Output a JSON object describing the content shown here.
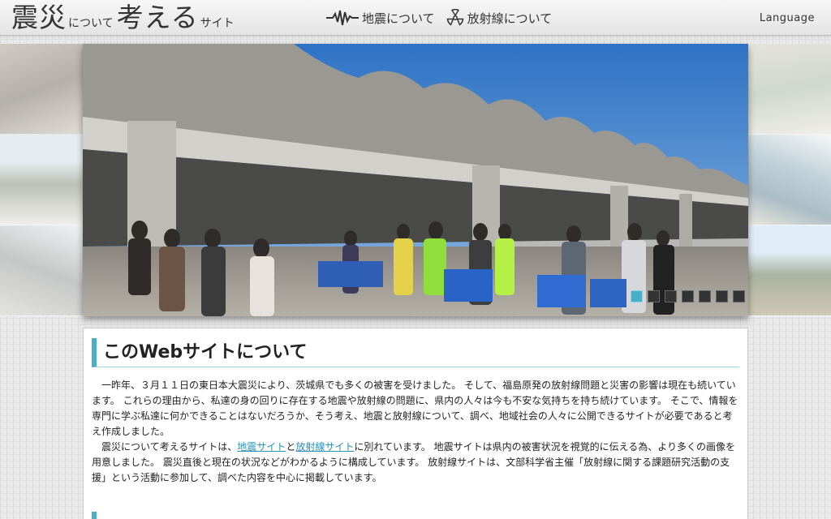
{
  "header": {
    "logo": {
      "part1": "震災",
      "part2": "について",
      "part3": "考える",
      "part4": "サイト"
    },
    "nav": [
      {
        "label": "地震について",
        "icon": "seismograph-icon"
      },
      {
        "label": "放射線について",
        "icon": "radiation-icon"
      }
    ],
    "language_label": "Language"
  },
  "slideshow": {
    "dots": 7,
    "active_index": 0
  },
  "about": {
    "title": "このWebサイトについて",
    "p1": "　一昨年、３月１１日の東日本大震災により、茨城県でも多くの被害を受けました。 そして、福島原発の放射線問題と災害の影響は現在も続いています。 これらの理由から、私達の身の回りに存在する地震や放射線の問題に、県内の人々は今も不安な気持ちを持ち続けています。 そこで、情報を専門に学ぶ私達に何かできることはないだろうか、そう考え、地震と放射線について、調べ、地域社会の人々に公開できるサイトが必要であると考え作成しました。",
    "p2_before": "　震災について考えるサイトは、",
    "link_quake": "地震サイト",
    "p2_and": "と",
    "link_radiation": "放射線サイト",
    "p2_after": "に別れています。 地震サイトは県内の被害状況を視覚的に伝える為、より多くの画像を用意しました。 震災直後と現在の状況などがわかるように構成しています。 放射線サイトは、文部科学省主催「放射線に関する課題研究活動の支援」という活動に参加して、調べた内容を中心に掲載しています。"
  },
  "colors": {
    "accent": "#46b1c6",
    "link": "#2a8fb8"
  }
}
